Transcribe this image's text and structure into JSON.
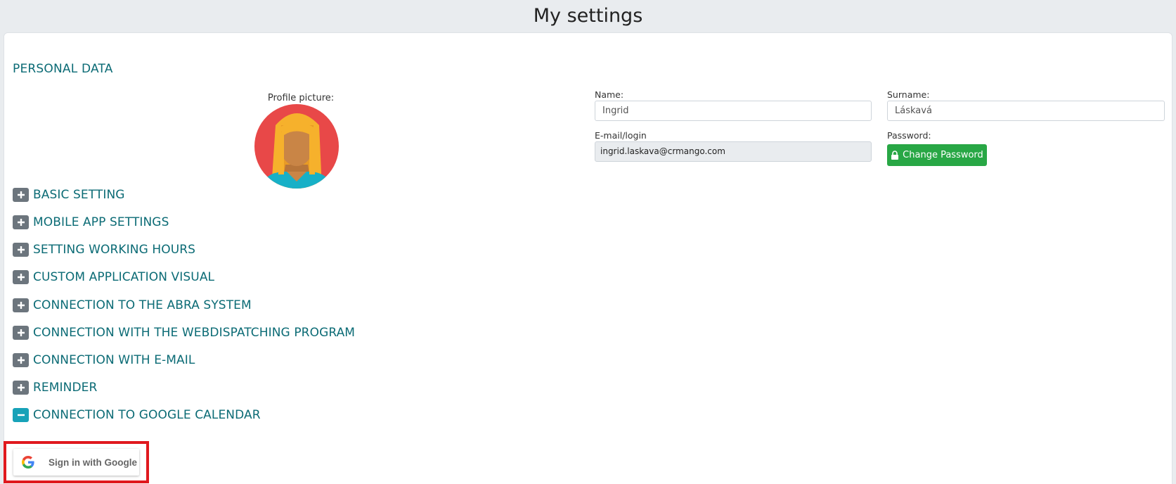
{
  "header": {
    "title": "My settings"
  },
  "personal": {
    "section_title": "PERSONAL DATA",
    "profile_label": "Profile picture:",
    "name_label": "Name:",
    "name_value": "Ingrid",
    "surname_label": "Surname:",
    "surname_value": "Láskavá",
    "email_label": "E-mail/login",
    "email_value": "ingrid.laskava@crmango.com",
    "password_label": "Password:",
    "change_password_label": "Change Password"
  },
  "accordion": {
    "items": [
      {
        "label": "BASIC SETTING",
        "expanded": false
      },
      {
        "label": "MOBILE APP SETTINGS",
        "expanded": false
      },
      {
        "label": "SETTING WORKING HOURS",
        "expanded": false
      },
      {
        "label": "CUSTOM APPLICATION VISUAL",
        "expanded": false
      },
      {
        "label": "CONNECTION TO THE ABRA SYSTEM",
        "expanded": false
      },
      {
        "label": "CONNECTION WITH THE WEBDISPATCHING PROGRAM",
        "expanded": false
      },
      {
        "label": "CONNECTION WITH E-MAIL",
        "expanded": false
      },
      {
        "label": "REMINDER",
        "expanded": false
      },
      {
        "label": "CONNECTION TO GOOGLE CALENDAR",
        "expanded": true
      }
    ]
  },
  "google": {
    "signin_label": "Sign in with Google"
  },
  "colors": {
    "accent_text": "#0b6b75",
    "success": "#28a745",
    "toggle_collapsed": "#6c757d",
    "toggle_expanded": "#17a2b8",
    "highlight": "#e0191e"
  },
  "icons": {
    "plus": "plus-icon",
    "minus": "minus-icon",
    "lock": "lock-icon",
    "google": "google-g-icon",
    "avatar": "avatar-icon"
  }
}
